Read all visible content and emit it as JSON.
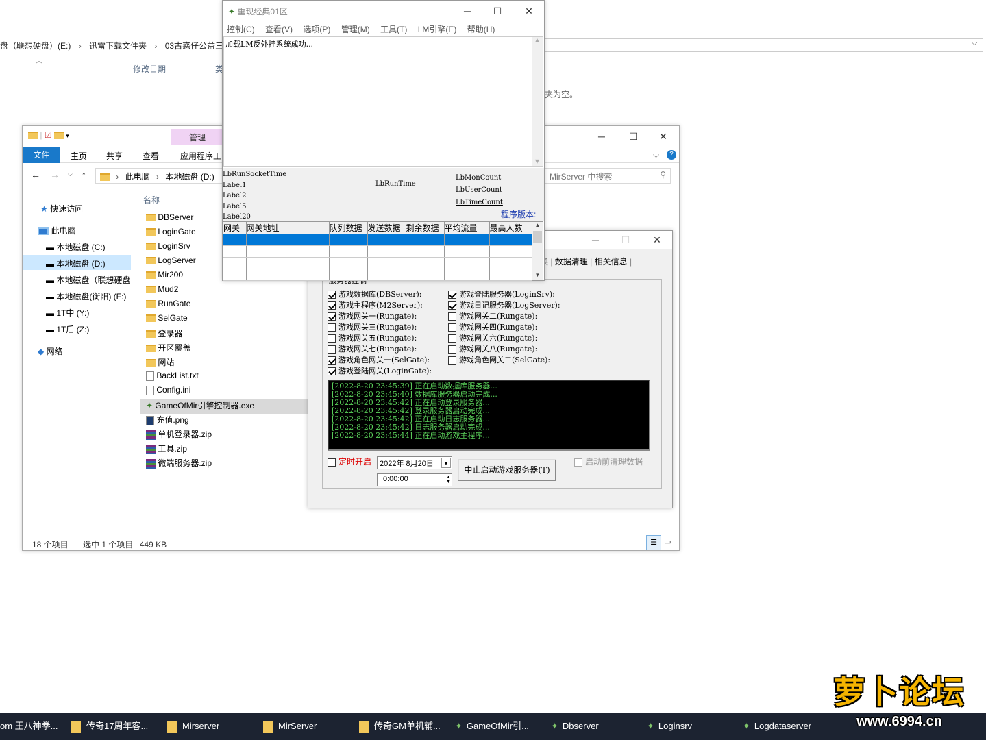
{
  "bg_explorer": {
    "breadcrumb": [
      "盘（联想硬盘）(E:)",
      "迅雷下载文件夹",
      "03古惑仔公益三"
    ],
    "col_modified": "修改日期",
    "col_type": "类",
    "empty_hint": "夹为空。"
  },
  "explorer": {
    "ribbon_manage": "管理",
    "ribbon_app_tools": "应用程序工",
    "tabs": [
      "文件",
      "主页",
      "共享",
      "查看"
    ],
    "address": [
      "此电脑",
      "本地磁盘 (D:)"
    ],
    "search_placeholder": "MirServer 中搜索",
    "nav": [
      "快速访问",
      "此电脑",
      "本地磁盘 (C:)",
      "本地磁盘 (D:)",
      "本地磁盘（联想硬盘",
      "本地磁盘(衡阳) (F:)",
      "1T中 (Y:)",
      "1T后 (Z:)",
      "网络"
    ],
    "col_name": "名称",
    "files": [
      "DBServer",
      "LoginGate",
      "LoginSrv",
      "LogServer",
      "Mir200",
      "Mud2",
      "RunGate",
      "SelGate",
      "登录器",
      "开区覆盖",
      "网站",
      "BackList.txt",
      "Config.ini",
      "GameOfMir引擎控制器.exe",
      "充值.png",
      "单机登录器.zip",
      "工具.zip",
      "微端服务器.zip"
    ],
    "status_count": "18 个项目",
    "status_selected": "选中 1 个项目",
    "status_size": "449 KB"
  },
  "control": {
    "tabs_visible": [
      "数据清理",
      "相关信息"
    ],
    "group_title": "服务器控制",
    "left_checks": [
      {
        "label": "游戏数据库(DBServer):",
        "checked": true
      },
      {
        "label": "游戏主程序(M2Server):",
        "checked": true
      },
      {
        "label": "游戏网关一(Rungate):",
        "checked": true
      },
      {
        "label": "游戏网关三(Rungate):",
        "checked": false
      },
      {
        "label": "游戏网关五(Rungate):",
        "checked": false
      },
      {
        "label": "游戏网关七(Rungate):",
        "checked": false
      },
      {
        "label": "游戏角色网关一(SelGate):",
        "checked": true
      },
      {
        "label": "游戏登陆网关(LoginGate):",
        "checked": true
      }
    ],
    "right_checks": [
      {
        "label": "游戏登陆服务器(LoginSrv):",
        "checked": true
      },
      {
        "label": "游戏日记服务器(LogServer):",
        "checked": true
      },
      {
        "label": "游戏网关二(Rungate):",
        "checked": false
      },
      {
        "label": "游戏网关四(Rungate):",
        "checked": false
      },
      {
        "label": "游戏网关六(Rungate):",
        "checked": false
      },
      {
        "label": "游戏网关八(Rungate):",
        "checked": false
      },
      {
        "label": "游戏角色网关二(SelGate):",
        "checked": false
      }
    ],
    "log": [
      {
        "time": "[2022-8-20 23:45:39]",
        "msg": "正在启动数据库服务器..."
      },
      {
        "time": "[2022-8-20 23:45:40]",
        "msg": "数据库服务器启动完成..."
      },
      {
        "time": "[2022-8-20 23:45:42]",
        "msg": "正在启动登录服务器..."
      },
      {
        "time": "[2022-8-20 23:45:42]",
        "msg": "登录服务器启动完成..."
      },
      {
        "time": "[2022-8-20 23:45:42]",
        "msg": "正在启动日志服务器..."
      },
      {
        "time": "[2022-8-20 23:45:42]",
        "msg": "日志服务器启动完成..."
      },
      {
        "time": "[2022-8-20 23:45:44]",
        "msg": "正在启动游戏主程序..."
      }
    ],
    "timer_label": "定时开启",
    "date_value": "2022年 8月20日",
    "time_value": "0:00:00",
    "stop_button": "中止启动游戏服务器(T)",
    "clean_label": "启动前清理数据"
  },
  "gamewin": {
    "title": "重现经典01区",
    "menu": [
      "控制(C)",
      "查看(V)",
      "选项(P)",
      "管理(M)",
      "工具(T)",
      "LM引擎(E)",
      "帮助(H)"
    ],
    "memo": "加载LM反外挂系统成功...",
    "labels_left": [
      "LbRunSocketTime",
      "Label1",
      "Label2",
      "Label5",
      "Label20"
    ],
    "label_mid": "LbRunTime",
    "labels_right": [
      "LbMonCount",
      "LbUserCount",
      "LbTimeCount"
    ],
    "version_label": "程序版本:",
    "grid_headers": [
      "网关",
      "网关地址",
      "队列数据",
      "发送数据",
      "剩余数据",
      "平均流量",
      "最高人数"
    ]
  },
  "taskbar": [
    "om 王八神拳...",
    "传奇17周年客...",
    "Mirserver",
    "MirServer",
    "传奇GM单机辅...",
    "GameOfMir引...",
    "Dbserver",
    "Loginsrv",
    "Logdataserver"
  ],
  "watermark": {
    "logo": "萝卜论坛",
    "url": "www.6994.cn"
  }
}
